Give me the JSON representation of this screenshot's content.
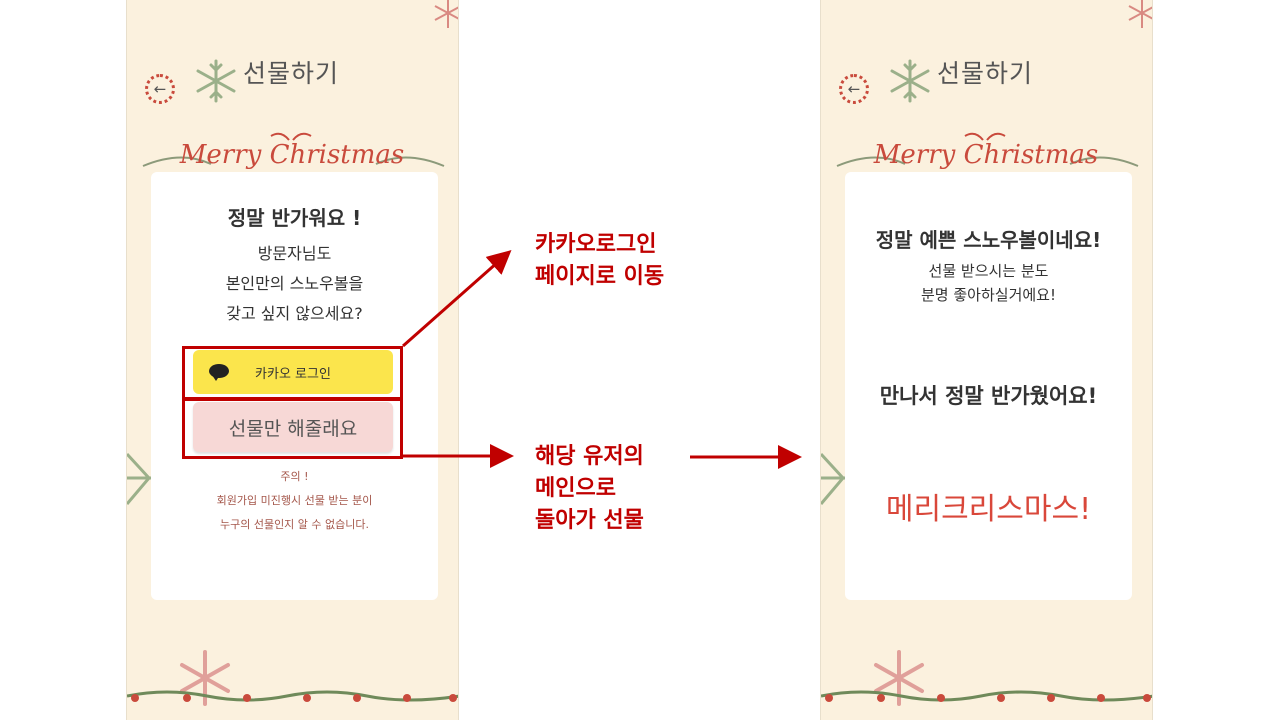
{
  "left_screen": {
    "header": {
      "back_icon": "arrow-left-icon",
      "snowflake_icon": "snowflake-icon",
      "title": "선물하기"
    },
    "banner": {
      "text": "Merry Christmas"
    },
    "card": {
      "greeting": "정말 반가워요 !",
      "line1": "방문자님도",
      "line2": "본인만의 스노우볼을",
      "line3": "갖고 싶지 않으세요?",
      "kakao_button": {
        "icon": "speech-bubble-icon",
        "label": "카카오 로그인",
        "color": "#fbe54c"
      },
      "gift_button": {
        "label": "선물만 해줄래요",
        "color": "#f7d8d6"
      },
      "notice": {
        "title": "주의 !",
        "line1": "회원가입 미진행시 선물 받는 분이",
        "line2": "누구의 선물인지 알 수 없습니다."
      }
    }
  },
  "right_screen": {
    "header": {
      "back_icon": "arrow-left-icon",
      "snowflake_icon": "snowflake-icon",
      "title": "선물하기"
    },
    "banner": {
      "text": "Merry Christmas"
    },
    "card": {
      "heading": "정말 예쁜 스노우볼이네요!",
      "line1": "선물 받으시는 분도",
      "line2": "분명 좋아하실거에요!",
      "nice_to_meet": "만나서 정말 반가웠어요!",
      "merry": "메리크리스마스!"
    }
  },
  "annotations": {
    "kakao_note_line1": "카카오로그인",
    "kakao_note_line2": "페이지로 이동",
    "gift_note_line1": "해당 유저의",
    "gift_note_line2": "메인으로",
    "gift_note_line3": "돌아가 선물",
    "color": "#c00000"
  },
  "colors": {
    "background": "#fbf1de",
    "accent_red": "#c94a3c",
    "card": "#ffffff"
  }
}
